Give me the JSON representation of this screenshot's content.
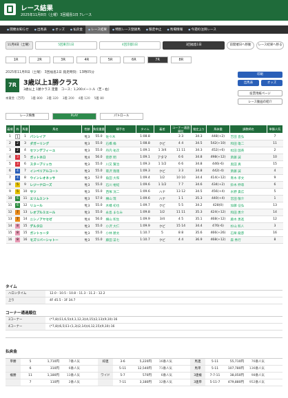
{
  "header": {
    "title": "レース結果",
    "subtitle": "2025年11月8日（土曜）3回福島1日 7レース"
  },
  "nav": [
    "開催お知らせ",
    "出馬表",
    "オッズ",
    "払戻金",
    "レース結果",
    "特別レース登録馬",
    "競走中止",
    "馬場情報",
    "今週の注目レース"
  ],
  "meets": {
    "date": "11月8日（土曜）",
    "items": [
      "5回東京1日",
      "4回京都1日",
      "3回福島1日"
    ],
    "links": [
      "前開催日へ移動",
      "レース結果へ移る"
    ]
  },
  "race_numbers": [
    "1R",
    "2R",
    "3R",
    "4R",
    "5R",
    "6R",
    "7R",
    "8R"
  ],
  "race": {
    "date": "2025年11月8日（土曜） 3回福島1日 発走時刻：13時05分",
    "badge": "7R",
    "name": "3歳以上1勝クラス",
    "cond": "3歳以上 1勝クラス 定量",
    "course": "コース：1,200メートル（芝・右）",
    "prize": [
      "本賞金（万円）",
      "1着 800",
      "2着 320",
      "3着 200",
      "4着 120",
      "5着 80"
    ]
  },
  "right_buttons": [
    "印刷",
    "出馬表",
    "オッズ",
    "投票用紙ページ",
    "レース動画の紹介"
  ],
  "tabs": [
    "レース映像",
    "PLAY",
    "パトロール"
  ],
  "columns": [
    "着順",
    "枠",
    "馬番",
    "馬名",
    "性齢",
    "負担重量",
    "騎手名",
    "タイム",
    "着差",
    "コーナー通過順位",
    "推定上り",
    "馬体重",
    "調教師名",
    "単勝人気"
  ],
  "rows": [
    [
      "1",
      "1",
      "1",
      "バシレイア",
      "牝3",
      "55.0",
      "佐々木",
      "1:08.8",
      "",
      "3 3",
      "34.3",
      "448(+2)",
      "吉田 直弘",
      "7"
    ],
    [
      "2",
      "2",
      "3",
      "ダガーリング",
      "牝3",
      "55.0",
      "石橋 脩",
      "1:08.8",
      "クビ",
      "4 4",
      "34.5",
      "542(+10)",
      "和田 雄二",
      "11"
    ],
    [
      "3",
      "2",
      "4",
      "セツンデフィーユ",
      "牝3",
      "55.0",
      "丹内 祐次",
      "1:09.1",
      "1 3/4",
      "11 11",
      "34.3",
      "452(+6)",
      "松田 国英",
      "2"
    ],
    [
      "4",
      "3",
      "5",
      "ガットネロ",
      "牝4",
      "56.0",
      "菅原 明",
      "1:09.1",
      "アタマ",
      "6 6",
      "34.8",
      "498(+12)",
      "斎藤 誠",
      "10"
    ],
    [
      "5",
      "3",
      "6",
      "スターブリッカ",
      "牝3",
      "55.0",
      "川又 賢治",
      "1:09.3",
      "1 1/2",
      "6 6",
      "34.8",
      "446(-6)",
      "奥田 真",
      "15"
    ],
    [
      "6",
      "4",
      "7",
      "インペリアルコート",
      "牝3",
      "55.0",
      "菊沢 隆徳",
      "1:09.3",
      "クビ",
      "3 3",
      "34.8",
      "442(-4)",
      "斎藤 誠",
      "4"
    ],
    [
      "7",
      "4",
      "8",
      "ウインレオネッサ",
      "牝3",
      "52.0",
      "角田 大和",
      "1:09.4",
      "1/2",
      "10 10",
      "34.4",
      "414(+12)",
      "青木 孝文",
      "9"
    ],
    [
      "8",
      "5",
      "9",
      "レジーナローズ",
      "牝3",
      "55.0",
      "石川 裕紀",
      "1:09.6",
      "1 1/2",
      "7 7",
      "34.6",
      "434(+2)",
      "鈴木 伸尋",
      "6"
    ],
    [
      "9",
      "5",
      "10",
      "サツ",
      "牝3",
      "55.0",
      "西塚 洸二",
      "1:09.6",
      "ハナ",
      "13 12",
      "34.5",
      "456(+4)",
      "水野 貴広",
      "5"
    ],
    [
      "10",
      "6",
      "11",
      "エリムミント",
      "牝3",
      "57.0",
      "横山 琉",
      "1:09.6",
      "ハナ",
      "1 1",
      "35.3",
      "440(+4)",
      "宮田 敬介",
      "1"
    ],
    [
      "11",
      "6",
      "12",
      "リュール",
      "牝3",
      "55.0",
      "木幡 初也",
      "1:09.7",
      "クビ",
      "5 5",
      "34.2",
      "428(0)",
      "加藤 征弘",
      "13"
    ],
    [
      "12",
      "7",
      "13",
      "レオプルミエール",
      "牝3",
      "55.0",
      "永島 まなみ",
      "1:09.8",
      "1/2",
      "11 11",
      "35.3",
      "424(+12)",
      "和田 勇介",
      "14"
    ],
    [
      "13",
      "7",
      "14",
      "ニシノアヤセゼ",
      "牝4",
      "56.0",
      "横山 和生",
      "1:09.9",
      "3/4",
      "4 5",
      "35.1",
      "468(+12)",
      "藤木 勇進",
      "12"
    ],
    [
      "14",
      "8",
      "15",
      "デルタロ",
      "牝3",
      "55.0",
      "小沢 大仁",
      "1:09.9",
      "クビ",
      "15 14",
      "34.4",
      "476(-6)",
      "杉山 和人",
      "3"
    ],
    [
      "15",
      "8",
      "15",
      "ガントゥータ",
      "牝3",
      "55.0",
      "小林 勝太",
      "1:10.7",
      "5",
      "8 8",
      "35.6",
      "466(+26)",
      "石栗 龍彦",
      "16"
    ],
    [
      "16",
      "8",
      "16",
      "モズリバーシャトー",
      "牝3",
      "55.0",
      "藤田 菜七",
      "1:10.7",
      "クビ",
      "4 4",
      "36.9",
      "468(+12)",
      "森 秀行",
      "8"
    ]
  ],
  "time": {
    "title": "タイム",
    "labels": [
      "ハロンタイム",
      "上り"
    ],
    "values": [
      "12.0 - 10.5 - 10.8 - 11.3 - 11.2 - 12.2",
      "4F 45.5 - 3F 34.7"
    ]
  },
  "corner": {
    "title": "コーナー通過順位",
    "labels": [
      "3コーナー",
      "4コーナー"
    ],
    "values": [
      "(*7,8)(11,6,5)(4,1,12,3)(4,15)(2,13)(9,10)-16",
      "(*7,8)(6,5)11-(1,3)(2,14)(4,12,15)(9,10)-16"
    ]
  },
  "payout": {
    "title": "払戻金",
    "rows": [
      [
        [
          "単勝",
          "5",
          "1,710円",
          "7番人気"
        ],
        [
          "枠連",
          "3-6",
          "5,220円",
          "16番人気"
        ],
        [
          "馬連",
          "5-11",
          "55,710円",
          "76番人気"
        ]
      ],
      [
        [
          "",
          "6",
          "310円",
          "6番人気"
        ],
        [
          "",
          "5-11",
          "12,540円",
          "71番人気"
        ],
        [
          "馬単",
          "5-11",
          "107,780円",
          "136番人気"
        ]
      ],
      [
        [
          "複勝",
          "11",
          "1,180円",
          "13番人気"
        ],
        [
          "ワイド",
          "5-7",
          "570円",
          "6番人気"
        ],
        [
          "3連複",
          "7-7-11",
          "38,050円",
          "98番人気"
        ]
      ],
      [
        [
          "",
          "7",
          "110円",
          "2番人気"
        ],
        [
          "",
          "7-11",
          "3,180円",
          "32番人気"
        ],
        [
          "3連単",
          "5-11-7",
          "479,880円",
          "952番人気"
        ]
      ]
    ]
  },
  "colors": {
    "brand": "#1f6b3a",
    "accent": "#2a5fb8"
  }
}
